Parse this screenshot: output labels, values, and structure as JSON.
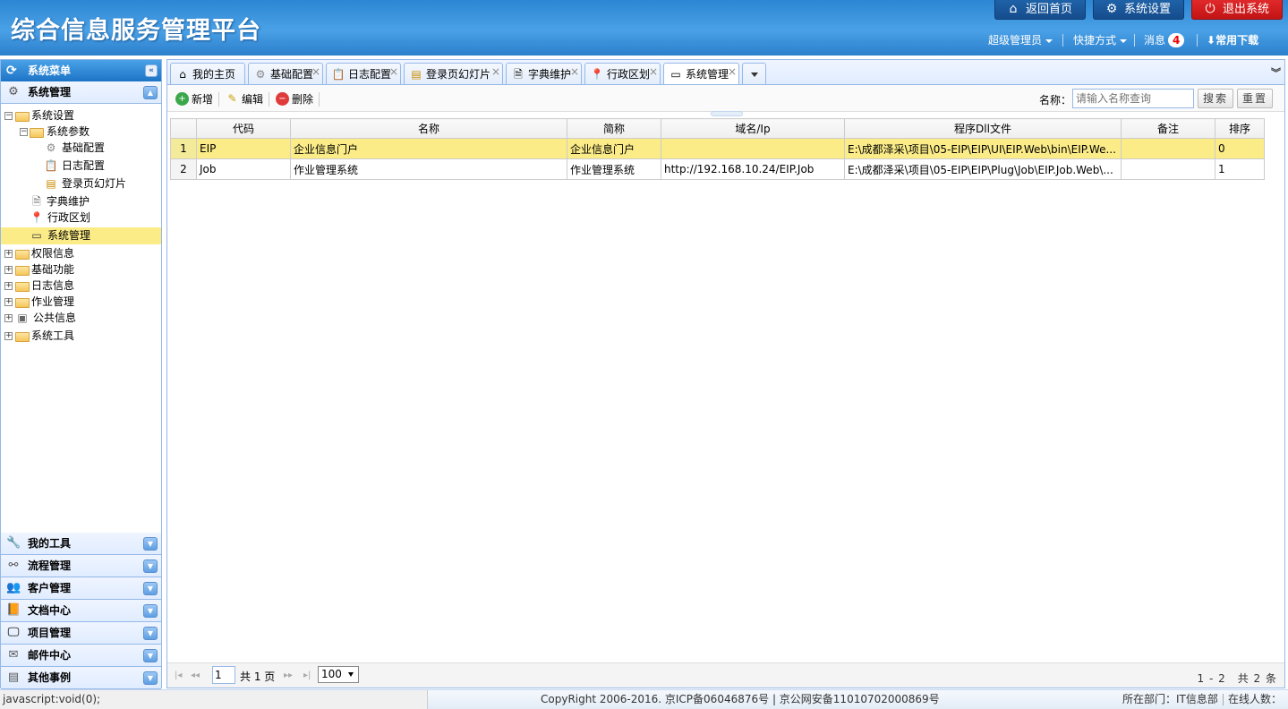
{
  "header": {
    "title": "综合信息服务管理平台",
    "home_label": "返回首页",
    "settings_label": "系统设置",
    "logout_label": "退出系统",
    "user_label": "超级管理员",
    "shortcuts_label": "快捷方式",
    "messages_label": "消息",
    "messages_count": "4",
    "downloads_label": "常用下载"
  },
  "sidebar": {
    "menu_title": "系统菜单",
    "active_panel": "系统管理",
    "tree": [
      {
        "label": "系统设置"
      },
      {
        "label": "系统参数"
      },
      {
        "label": "基础配置"
      },
      {
        "label": "日志配置"
      },
      {
        "label": "登录页幻灯片"
      },
      {
        "label": "字典维护"
      },
      {
        "label": "行政区划"
      },
      {
        "label": "系统管理"
      },
      {
        "label": "权限信息"
      },
      {
        "label": "基础功能"
      },
      {
        "label": "日志信息"
      },
      {
        "label": "作业管理"
      },
      {
        "label": "公共信息"
      },
      {
        "label": "系统工具"
      }
    ],
    "panels": [
      {
        "label": "我的工具"
      },
      {
        "label": "流程管理"
      },
      {
        "label": "客户管理"
      },
      {
        "label": "文档中心"
      },
      {
        "label": "项目管理"
      },
      {
        "label": "邮件中心"
      },
      {
        "label": "其他事例"
      }
    ]
  },
  "tabs": [
    {
      "label": "我的主页"
    },
    {
      "label": "基础配置"
    },
    {
      "label": "日志配置"
    },
    {
      "label": "登录页幻灯片"
    },
    {
      "label": "字典维护"
    },
    {
      "label": "行政区划"
    },
    {
      "label": "系统管理"
    }
  ],
  "toolbar": {
    "add_label": "新增",
    "edit_label": "编辑",
    "delete_label": "删除",
    "search_label": "名称：",
    "search_placeholder": "请输入名称查询",
    "search_btn": "搜索",
    "reset_btn": "重置"
  },
  "grid": {
    "columns": [
      "代码",
      "名称",
      "简称",
      "域名/Ip",
      "程序Dll文件",
      "备注",
      "排序"
    ],
    "rows": [
      {
        "num": "1",
        "code": "EIP",
        "name": "企业信息门户",
        "short": "企业信息门户",
        "domain": "",
        "dll": "E:\\成都泽采\\项目\\05-EIP\\EIP\\UI\\EIP.Web\\bin\\EIP.We...",
        "remark": "",
        "order": "0"
      },
      {
        "num": "2",
        "code": "Job",
        "name": "作业管理系统",
        "short": "作业管理系统",
        "domain": "http://192.168.10.24/EIP.Job",
        "dll": "E:\\成都泽采\\项目\\05-EIP\\EIP\\Plug\\Job\\EIP.Job.Web\\...",
        "remark": "",
        "order": "1"
      }
    ]
  },
  "pager": {
    "page": "1",
    "total_pages": "共 1 页",
    "page_size": "100",
    "info": "1 - 2　共 2 条"
  },
  "status": {
    "url": "javascript:void(0);",
    "copyright": "CopyRight 2006-2016. 京ICP备06046876号 | 京公网安备11010702000869号",
    "dept": "所在部门：IT信息部",
    "online": "在线人数："
  },
  "colors": {
    "header_blue": "#3a94dc",
    "selected_row": "#fbec88",
    "logout_red": "#d61f1f",
    "border_blue": "#95b8e7"
  }
}
